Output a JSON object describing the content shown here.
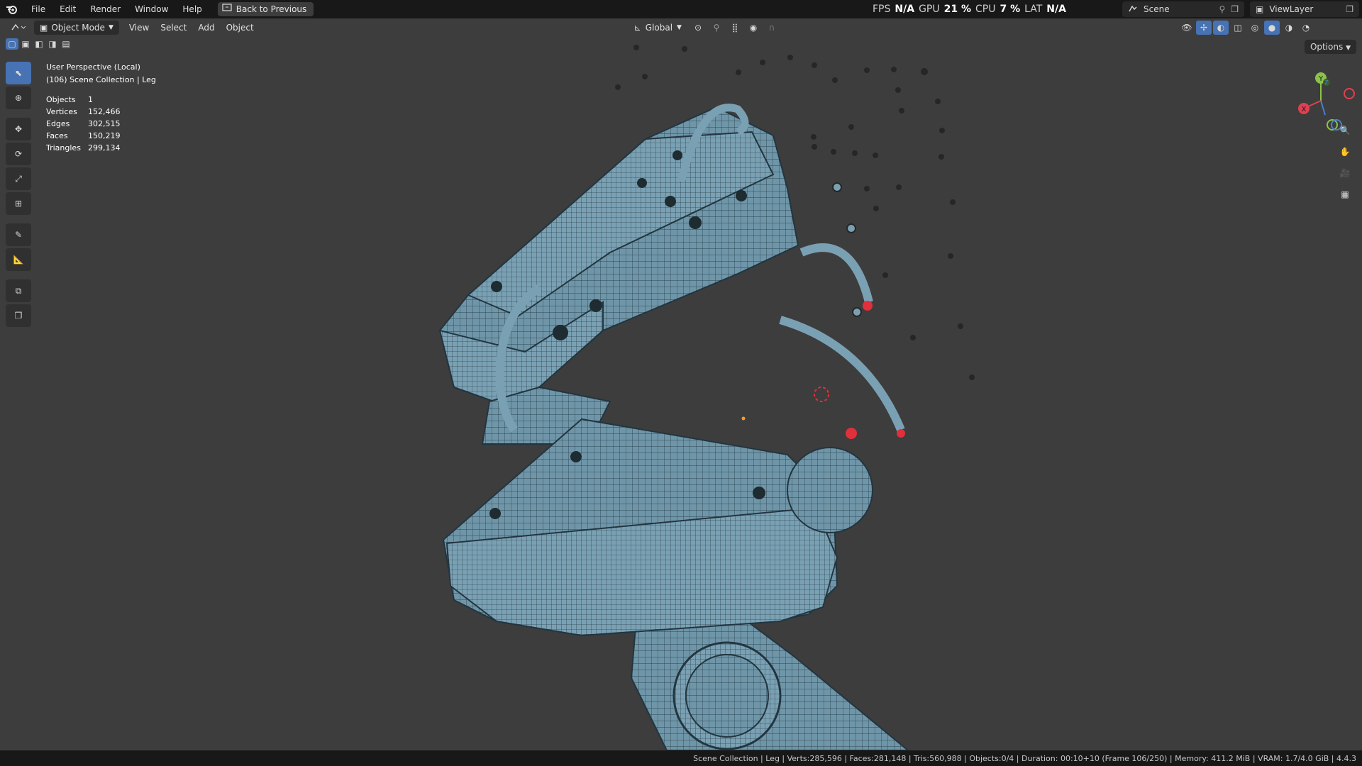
{
  "menu": {
    "items": [
      "File",
      "Edit",
      "Render",
      "Window",
      "Help"
    ],
    "back_button": "Back to Previous"
  },
  "performance": {
    "fps_label": "FPS",
    "fps_value": "N/A",
    "gpu_label": "GPU",
    "gpu_value": "21 %",
    "cpu_label": "CPU",
    "cpu_value": "7 %",
    "lat_label": "LAT",
    "lat_value": "N/A"
  },
  "scene": {
    "name": "Scene"
  },
  "view_layer": {
    "name": "ViewLayer"
  },
  "viewport_header": {
    "mode": "Object Mode",
    "menus": [
      "View",
      "Select",
      "Add",
      "Object"
    ],
    "transform_orientation": "Global",
    "options_label": "Options"
  },
  "overlay": {
    "perspective": "User Perspective (Local)",
    "collection": "(106) Scene Collection | Leg"
  },
  "stats": [
    {
      "label": "Objects",
      "value": "1"
    },
    {
      "label": "Vertices",
      "value": "152,466"
    },
    {
      "label": "Edges",
      "value": "302,515"
    },
    {
      "label": "Faces",
      "value": "150,219"
    },
    {
      "label": "Triangles",
      "value": "299,134"
    }
  ],
  "tools": [
    "select-box-tool",
    "cursor-tool",
    "move-tool",
    "rotate-tool",
    "scale-tool",
    "transform-tool",
    "annotate-tool",
    "measure-tool",
    "add-cube-tool",
    "extrude-tool"
  ],
  "gizmo_axes": {
    "y": "Y",
    "x": "X",
    "z": "Z"
  },
  "status_bar": "Scene Collection | Leg | Verts:285,596 | Faces:281,148 | Tris:560,988 | Objects:0/4 | Duration: 00:10+10 (Frame 106/250) | Memory: 411.2 MiB | VRAM: 1.7/4.0 GiB | 4.4.3",
  "colors": {
    "viewport_bg": "#3d3d3d",
    "mesh_fill": "#6f96a8",
    "wire": "#2e4652",
    "accent": "#4772b3"
  }
}
